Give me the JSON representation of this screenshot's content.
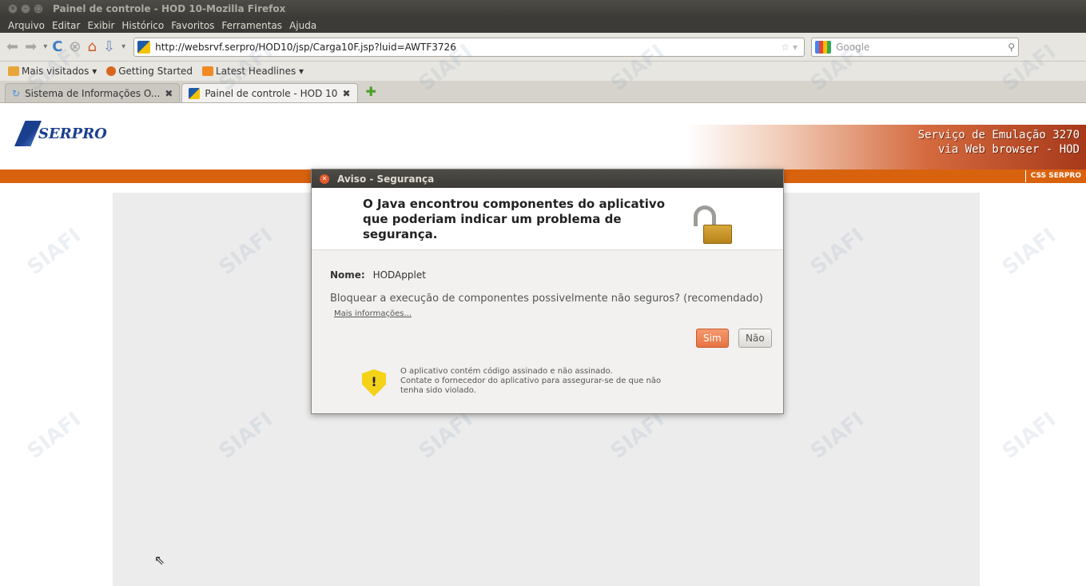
{
  "window": {
    "title": "Painel de controle - HOD 10-Mozilla Firefox",
    "controls": [
      "✕",
      "–",
      "□"
    ]
  },
  "menubar": {
    "items": [
      "Arquivo",
      "Editar",
      "Exibir",
      "Histórico",
      "Favoritos",
      "Ferramentas",
      "Ajuda"
    ]
  },
  "navbar": {
    "url": "http://websrvf.serpro/HOD10/jsp/Carga10F.jsp?luid=AWTF3726",
    "search_placeholder": "Google"
  },
  "bookmarks": {
    "items": [
      "Mais visitados ▾",
      "Getting Started",
      "Latest Headlines ▾"
    ]
  },
  "tabs": {
    "items": [
      "Sistema de Informações O...",
      "Painel de controle - HOD 10"
    ]
  },
  "page": {
    "logo_text": "SERPRO",
    "banner_line1": "Serviço de Emulação 3270",
    "banner_line2": "via Web browser - HOD",
    "css_tag": "CSS SERPRO",
    "watermark": "SIAFI"
  },
  "dialog": {
    "title": "Aviso - Segurança",
    "heading": "O Java encontrou componentes do aplicativo que poderiam indicar um problema de segurança.",
    "name_label": "Nome:",
    "name_value": "HODApplet",
    "question": "Bloquear a execução de componentes possivelmente não seguros? (recomendado)",
    "more_info": "Mais informações...",
    "yes_label": "Sim",
    "no_label": "Não",
    "warning_line1": "O aplicativo contém código assinado e não assinado.",
    "warning_line2": "Contate o fornecedor do aplicativo para assegurar-se de que não",
    "warning_line3": "tenha sido violado."
  }
}
